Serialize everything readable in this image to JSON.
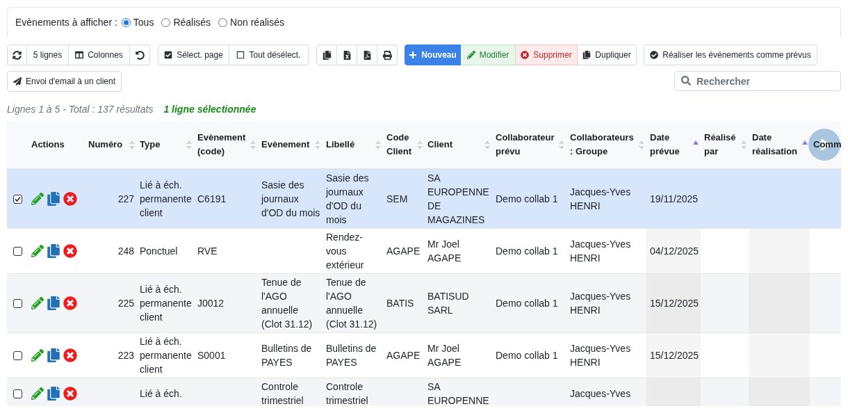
{
  "filter": {
    "label": "Evènements à afficher :",
    "options": [
      {
        "label": "Tous",
        "selected": true
      },
      {
        "label": "Réalisés",
        "selected": false
      },
      {
        "label": "Non réalisés",
        "selected": false
      }
    ]
  },
  "toolbar": {
    "rows_button": "5 lignes",
    "columns_button": "Colonnes",
    "select_page_button": "Sélect. page",
    "deselect_all_button": "Tout désélect.",
    "record_buttons": [
      {
        "label": "Nouveau",
        "kind": "primary"
      },
      {
        "label": "Modifier",
        "kind": "success"
      },
      {
        "label": "Supprimer",
        "kind": "danger"
      },
      {
        "label": "Dupliquer",
        "kind": "default"
      }
    ],
    "realize_button": "Réaliser les événements comme prévus",
    "email_button": "Envoi d'email à un client"
  },
  "search": {
    "placeholder": "Rechercher"
  },
  "summary": {
    "range": "Lignes 1 à 5 - Total : 137 résultats",
    "selection": "1 ligne sélectionnée"
  },
  "table": {
    "columns": [
      {
        "label": "Actions",
        "kind": "plain"
      },
      {
        "label": "Numéro",
        "kind": "sortable"
      },
      {
        "label": "Type",
        "kind": "sortable"
      },
      {
        "label": "Evènement (code)",
        "kind": "sortable"
      },
      {
        "label": "Evènement",
        "kind": "sortable"
      },
      {
        "label": "Libellé",
        "kind": "sortable"
      },
      {
        "label": "Code Client",
        "kind": "sortable"
      },
      {
        "label": "Client",
        "kind": "sortable"
      },
      {
        "label": "Collaborateur prévu",
        "kind": "sortable"
      },
      {
        "label": "Collaborateurs : Groupe",
        "kind": "sortable"
      },
      {
        "label": "Date prévue",
        "kind": "sorted"
      },
      {
        "label": "Réalisé par",
        "kind": "sortable"
      },
      {
        "label": "Date réalisation",
        "kind": "sorted"
      },
      {
        "label": "Comm",
        "kind": "plain"
      }
    ],
    "rows": [
      {
        "selected": true,
        "numero": "227",
        "type": "Lié à éch. permanente client",
        "evenement_code": "C6191",
        "evenement": "Sasie des journaux d'OD du mois",
        "libelle": "Sasie des journaux d'OD du mois",
        "code_client": "SEM",
        "client": "SA EUROPENNE DE MAGAZINES",
        "collaborateur_prevu": "Demo collab 1",
        "collaborateurs_groupe": "Jacques-Yves HENRI",
        "date_prevue": "19/11/2025"
      },
      {
        "selected": false,
        "numero": "248",
        "type": "Ponctuel",
        "evenement_code": "RVE",
        "libelle": "Rendez-vous extérieur",
        "code_client": "AGAPE",
        "client": "Mr Joel AGAPE",
        "collaborateur_prevu": "Demo collab 1",
        "collaborateurs_groupe": "Jacques-Yves HENRI",
        "date_prevue": "04/12/2025"
      },
      {
        "selected": false,
        "numero": "225",
        "type": "Lié à éch. permanente client",
        "evenement_code": "J0012",
        "evenement": "Tenue de l'AGO annuelle (Clot 31.12)",
        "libelle": "Tenue de l'AGO annuelle (Clot 31.12)",
        "code_client": "BATIS",
        "client": "BATISUD SARL",
        "collaborateur_prevu": "Demo collab 1",
        "collaborateurs_groupe": "Jacques-Yves HENRI",
        "date_prevue": "15/12/2025"
      },
      {
        "selected": false,
        "numero": "223",
        "type": "Lié à éch. permanente client",
        "evenement_code": "S0001",
        "evenement": "Bulletins de PAYES",
        "libelle": "Bulletins de PAYES",
        "code_client": "AGAPE",
        "client": "Mr Joel AGAPE",
        "collaborateur_prevu": "Demo collab 1",
        "collaborateurs_groupe": "Jacques-Yves HENRI",
        "date_prevue": "15/12/2025"
      },
      {
        "selected": false,
        "type": "Lié à éch.",
        "evenement": "Controle trimestriel",
        "libelle": "Controle trimestriel",
        "client": "SA EUROPENNE",
        "collaborateurs_groupe": "Jacques-Yves"
      }
    ]
  }
}
